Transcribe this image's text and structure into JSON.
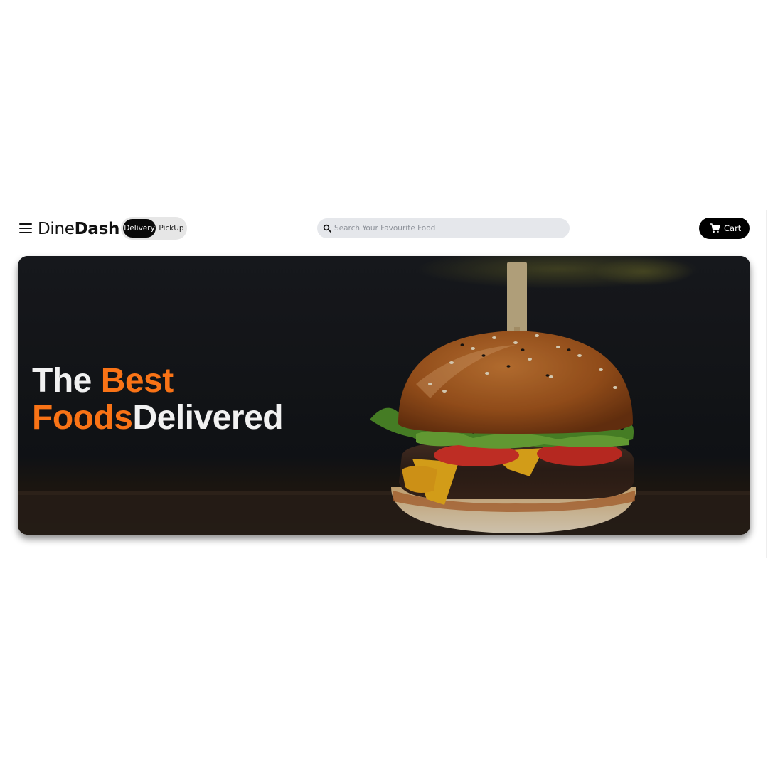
{
  "brand": {
    "name_light": "Dine",
    "name_bold": "Dash"
  },
  "mode_toggle": {
    "active": "Delivery",
    "other": "PickUp"
  },
  "search": {
    "placeholder": "Search Your Favourite Food",
    "icon": "search-icon"
  },
  "cart": {
    "label": "Cart",
    "icon": "cart-icon"
  },
  "hero": {
    "title_word_1": "The",
    "title_word_2": "Best",
    "title_word_3": "Foods",
    "title_word_4": "Delivered",
    "image": "burger-image"
  },
  "colors": {
    "accent": "#f97316",
    "dark": "#000000",
    "search_bg": "#e5e7eb",
    "toggle_bg": "#e6e6e6"
  }
}
